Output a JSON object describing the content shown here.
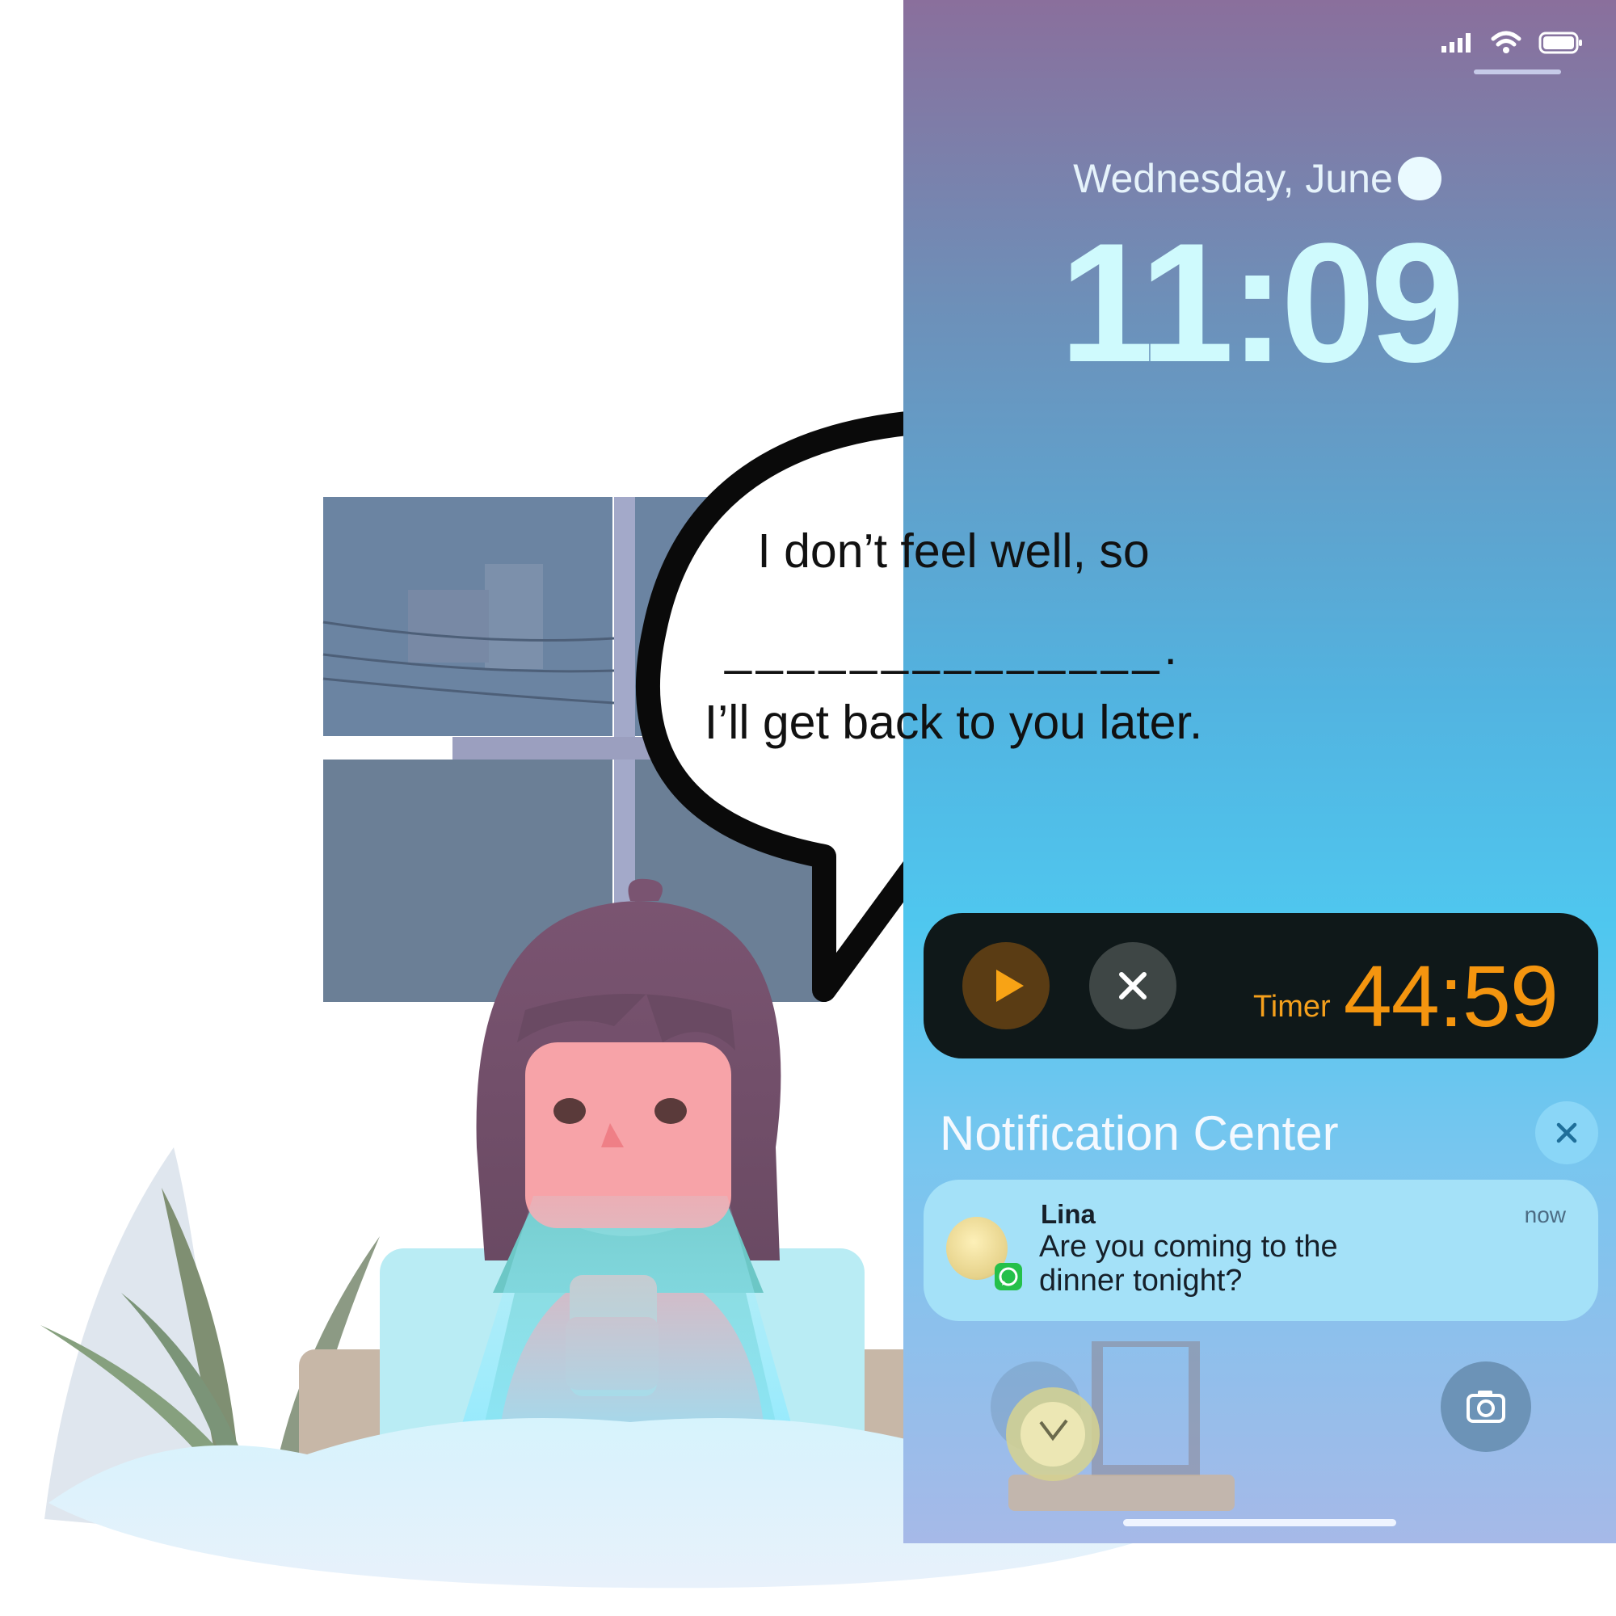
{
  "lockscreen": {
    "date": "Wednesday, June",
    "time": "11:09",
    "live_activity": {
      "timer_label": "Timer",
      "timer_value": "44:59"
    },
    "notification_center": {
      "title": "Notification Center",
      "notifications": [
        {
          "sender": "Lina",
          "time": "now",
          "message_line1": "Are you coming to the",
          "message_line2": "dinner tonight?"
        }
      ]
    }
  },
  "speech_bubble": {
    "line1": "I don’t feel well, so",
    "blank": "______________.",
    "line3": "I’ll get back to you later."
  },
  "colors": {
    "timer_accent": "#f4950f",
    "whatsapp_green": "#25c04a",
    "time_text": "#cffafd"
  }
}
